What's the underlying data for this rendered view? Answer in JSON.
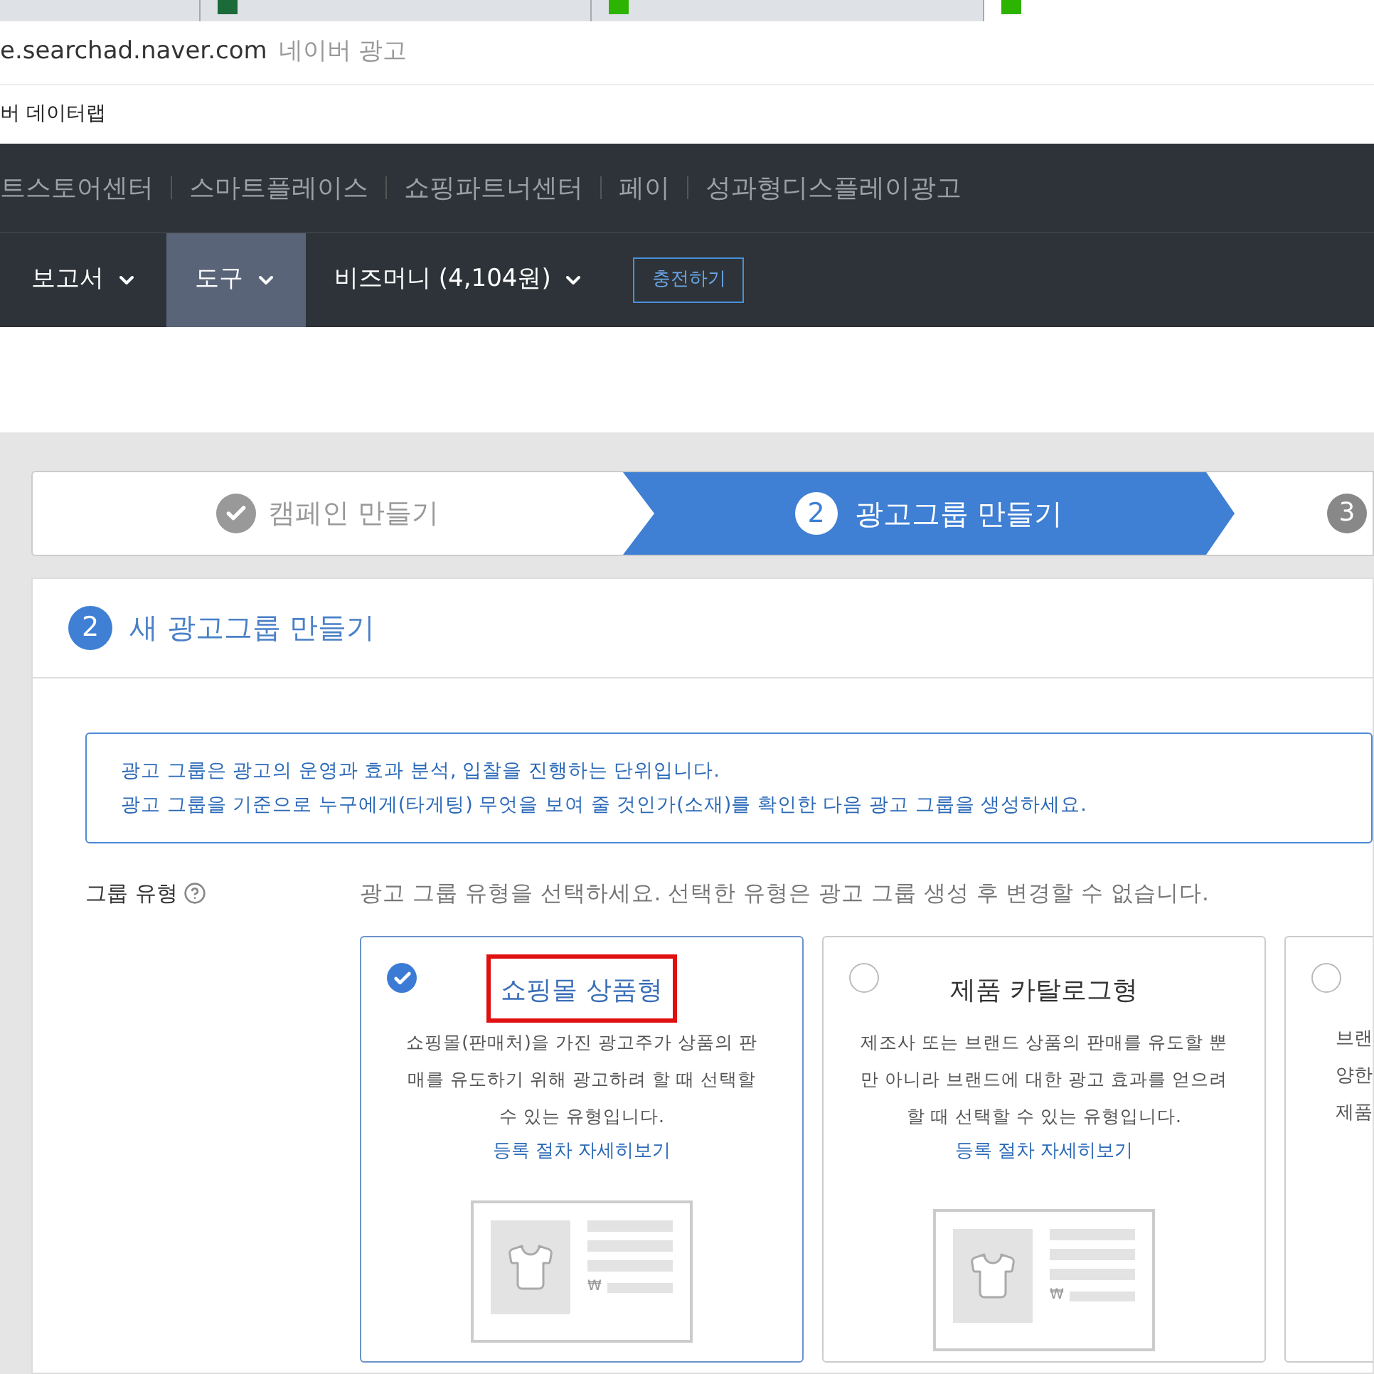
{
  "browser": {
    "tabs": [
      {
        "selected": false
      },
      {
        "selected": false
      },
      {
        "selected": true
      }
    ],
    "url": "e.searchad.naver.com",
    "page_title": "네이버 광고",
    "bookmark": "버 데이터랩"
  },
  "top_links": [
    "트스토어센터",
    "스마트플레이스",
    "쇼핑파트너센터",
    "페이",
    "성과형디스플레이광고"
  ],
  "menu": [
    {
      "label": "보고서",
      "selected": false
    },
    {
      "label": "도구",
      "selected": true
    },
    {
      "label": "비즈머니 (4,104원)",
      "selected": false
    }
  ],
  "charge_button": "충전하기",
  "steps": [
    {
      "kind": "done",
      "label": "캠페인 만들기"
    },
    {
      "kind": "current",
      "number": "2",
      "label": "광고그룹 만들기"
    },
    {
      "kind": "upcoming",
      "number": "3"
    }
  ],
  "section": {
    "number": "2",
    "title": "새 광고그룹 만들기"
  },
  "info": [
    "광고 그룹은 광고의 운영과 효과 분석, 입찰을 진행하는 단위입니다.",
    "광고 그룹을 기준으로 누구에게(타게팅) 무엇을 보여 줄 것인가(소재)를 확인한 다음 광고 그룹을 생성하세요."
  ],
  "group_type": {
    "label": "그룹 유형",
    "hint": "광고 그룹 유형을 선택하세요. 선택한 유형은 광고 그룹 생성 후 변경할 수 없습니다."
  },
  "cards": [
    {
      "selected": true,
      "highlighted": true,
      "title": "쇼핑몰 상품형",
      "description": "쇼핑몰(판매처)을 가진 광고주가 상품의 판매를 유도하기 위해 광고하려 할 때 선택할 수 있는 유형입니다.",
      "link": "등록 절차 자세히보기",
      "price_sign": "₩"
    },
    {
      "selected": false,
      "highlighted": false,
      "title": "제품 카탈로그형",
      "description": "제조사 또는 브랜드 상품의 판매를 유도할 뿐만 아니라 브랜드에 대한 광고 효과를 얻으려 할 때 선택할 수 있는 유형입니다.",
      "link": "등록 절차 자세히보기",
      "price_sign": "₩"
    },
    {
      "selected": false,
      "lines": [
        "브랜",
        "양한",
        "제품"
      ]
    }
  ]
}
